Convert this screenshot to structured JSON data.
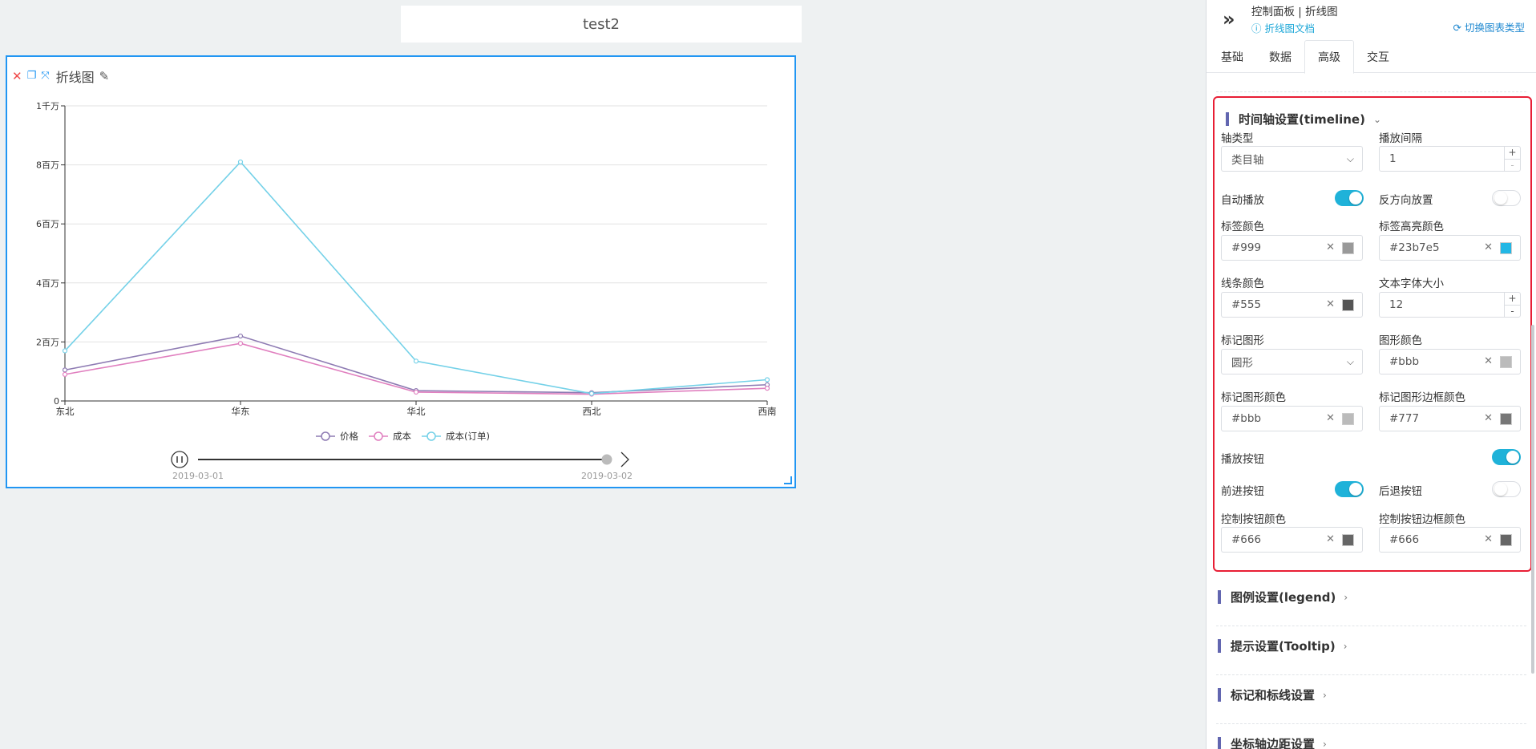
{
  "canvas": {
    "title": "test2",
    "widget_title": "折线图"
  },
  "chart_data": {
    "type": "line",
    "categories": [
      "东北",
      "华东",
      "华北",
      "西北",
      "西南"
    ],
    "y_ticks": [
      "0",
      "2百万",
      "4百万",
      "6百万",
      "8百万",
      "1千万"
    ],
    "ylim": [
      0,
      10000000
    ],
    "grid": true,
    "legend_position": "bottom",
    "series": [
      {
        "name": "价格",
        "values": [
          1050000,
          2200000,
          350000,
          280000,
          550000
        ],
        "color": "#8e7bb3"
      },
      {
        "name": "成本",
        "values": [
          900000,
          1950000,
          300000,
          230000,
          430000
        ],
        "color": "#e07fbf"
      },
      {
        "name": "成本(订单)",
        "values": [
          1700000,
          8100000,
          1350000,
          250000,
          720000
        ],
        "color": "#74d1e8"
      }
    ],
    "timeline": {
      "labels": [
        "2019-03-01",
        "2019-03-02"
      ],
      "current_index": 1
    }
  },
  "panel": {
    "breadcrumb": "控制面板 | 折线图",
    "doc_link": "折线图文档",
    "switch_type": "切换图表类型",
    "tabs": [
      {
        "label": "基础",
        "active": false
      },
      {
        "label": "数据",
        "active": false
      },
      {
        "label": "高级",
        "active": true
      },
      {
        "label": "交互",
        "active": false
      }
    ],
    "timeline_section": {
      "title": "时间轴设置(timeline)",
      "axis_type_label": "轴类型",
      "axis_type_value": "类目轴",
      "play_interval_label": "播放间隔",
      "play_interval_value": "1",
      "auto_play_label": "自动播放",
      "auto_play": true,
      "inverse_label": "反方向放置",
      "inverse": false,
      "label_color_label": "标签颜色",
      "label_color": "#999",
      "label_highlight_label": "标签高亮颜色",
      "label_highlight_color": "#23b7e5",
      "line_color_label": "线条颜色",
      "line_color": "#555",
      "font_size_label": "文本字体大小",
      "font_size": "12",
      "symbol_label": "标记图形",
      "symbol_value": "圆形",
      "shape_color_label": "图形颜色",
      "shape_color": "#bbb",
      "symbol_color_label": "标记图形颜色",
      "symbol_color": "#bbb",
      "symbol_border_label": "标记图形边框颜色",
      "symbol_border_color": "#777",
      "play_button_label": "播放按钮",
      "play_button": true,
      "forward_label": "前进按钮",
      "forward": true,
      "backward_label": "后退按钮",
      "backward": false,
      "control_color_label": "控制按钮颜色",
      "control_color": "#666",
      "control_border_label": "控制按钮边框颜色",
      "control_border_color": "#666"
    },
    "collapsed_sections": [
      "图例设置(legend)",
      "提示设置(Tooltip)",
      "标记和标线设置",
      "坐标轴边距设置"
    ]
  }
}
